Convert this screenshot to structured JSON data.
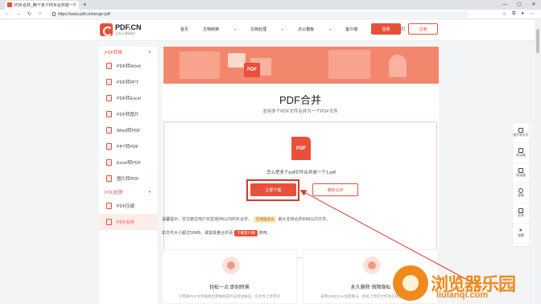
{
  "browser": {
    "tab_title": "PDF合并_两个多个PDF合并成一...",
    "url": "https://www.pdf.cn/merge-pdf"
  },
  "header": {
    "brand": "PDF.CN",
    "slogan": "让办公更轻松！",
    "nav": [
      "首页",
      "文档转换",
      "文档处理",
      "办公模板",
      "客户端",
      "联系我们"
    ],
    "login": "登录",
    "register": "注册"
  },
  "sidebar": {
    "cat1": "PDF转换",
    "items1": [
      "PDF转Word",
      "PDF转PPT",
      "PDF转Excel",
      "PDF转图片",
      "Word转PDF",
      "PPT转PDF",
      "Excel转PDF",
      "图片转PDF"
    ],
    "cat2": "PDF处理",
    "items2": [
      "PDF压缩",
      "PDF合并"
    ]
  },
  "main": {
    "banner_pdf": "PDF",
    "title": "PDF合并",
    "subtitle": "支持多个PDF文件合并为一个PDF文件",
    "file_icon": "PDF",
    "file_name": "怎么把多个pdf文件合并成一个1.pdf",
    "download": "立即下载",
    "reset": "重新合并",
    "tip1_a": "温馨提示：非注册过用户仅支持2M以内PDF合并，",
    "tip1_vip": "在线版会员",
    "tip1_b": "最大支持合并50M以内文件。",
    "tip2_a": "如文件大小超过50MB，或需批量合并请",
    "tip2_dl": "下载客户端",
    "tip2_b": "使用。",
    "feat1_title": "轻松一点 即刻转换",
    "feat1_desc": "只需将PDF文件拖拽至转换框或点击添加按钮，在文件上传完毕",
    "feat2_title": "永久删除 保障隐私",
    "feat2_desc": "采用256位SSL加密算法，所有上传的文件会在转换完成后删除"
  },
  "right_panel": [
    "图片转文字",
    "阅读器",
    "阅读器",
    "客服",
    "反馈",
    "收藏"
  ],
  "watermark": {
    "text": "浏览器乐园",
    "sub": "liulanqi.com"
  },
  "colors": {
    "accent": "#e8503a",
    "watermark": "#f08a1e"
  }
}
